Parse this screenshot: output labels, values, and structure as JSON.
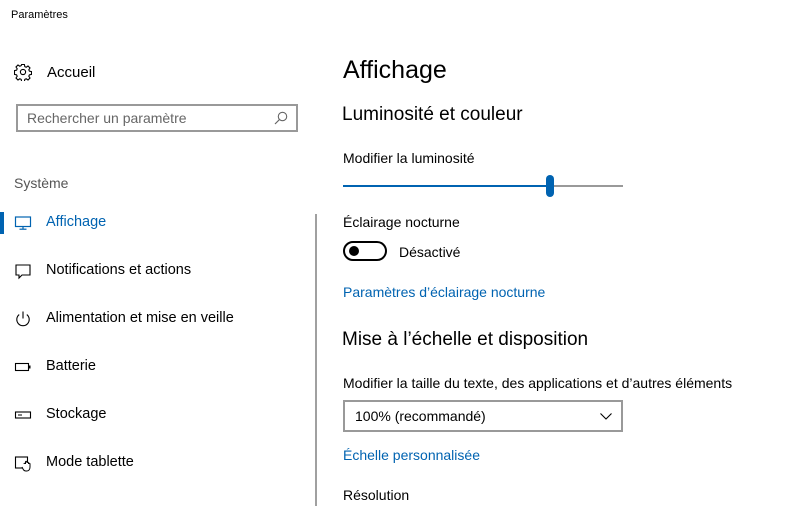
{
  "window": {
    "title": "Paramètres"
  },
  "sidebar": {
    "home_label": "Accueil",
    "search": {
      "placeholder": "Rechercher un paramètre",
      "value": ""
    },
    "section_label": "Système",
    "items": [
      {
        "label": "Affichage",
        "icon": "monitor-icon",
        "selected": true
      },
      {
        "label": "Notifications et actions",
        "icon": "notification-icon",
        "selected": false
      },
      {
        "label": "Alimentation et mise en veille",
        "icon": "power-icon",
        "selected": false
      },
      {
        "label": "Batterie",
        "icon": "battery-icon",
        "selected": false
      },
      {
        "label": "Stockage",
        "icon": "storage-icon",
        "selected": false
      },
      {
        "label": "Mode tablette",
        "icon": "tablet-mode-icon",
        "selected": false
      }
    ]
  },
  "main": {
    "title": "Affichage",
    "brightness_section": {
      "heading": "Luminosité et couleur",
      "brightness_label": "Modifier la luminosité",
      "brightness_value": 0.74,
      "night_light_label": "Éclairage nocturne",
      "night_light_on": false,
      "night_light_state": "Désactivé",
      "night_light_settings_link": "Paramètres d’éclairage nocturne"
    },
    "scale_section": {
      "heading": "Mise à l’échelle et disposition",
      "scale_label": "Modifier la taille du texte, des applications et d’autres éléments",
      "scale_selected": "100% (recommandé)",
      "custom_scale_link": "Échelle personnalisée",
      "resolution_label": "Résolution"
    }
  },
  "colors": {
    "accent": "#0063B1",
    "text": "#000000",
    "secondary_text": "#555555",
    "border": "#999999"
  }
}
